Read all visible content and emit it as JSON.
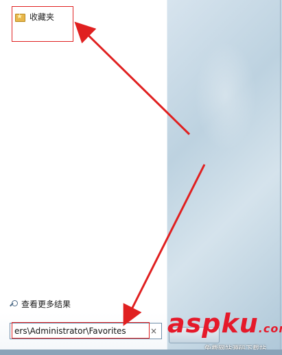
{
  "start_menu": {
    "favorites_label": "收藏夹",
    "see_more_label": "查看更多结果",
    "search_value": "ers\\Administrator\\Favorites",
    "clear_glyph": "×"
  },
  "watermark": {
    "brand": "asp",
    "brand_ku": "ku",
    "brand_tld": ".com",
    "tagline": "免费网站源码下载站"
  },
  "colors": {
    "annotation_red": "#e02020",
    "watermark_red": "#e5192a",
    "folder": "#e8b64a"
  },
  "icons": [
    "folder-favorites-icon",
    "search-icon",
    "clear-icon",
    "arrow-annotation"
  ]
}
